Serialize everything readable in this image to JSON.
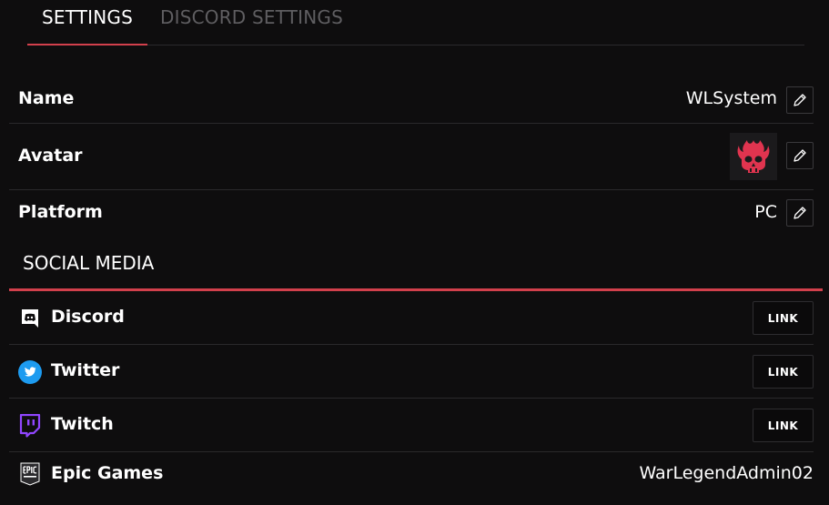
{
  "tabs": [
    {
      "label": "SETTINGS",
      "active": true
    },
    {
      "label": "DISCORD SETTINGS",
      "active": false
    }
  ],
  "settings": {
    "name": {
      "label": "Name",
      "value": "WLSystem"
    },
    "avatar": {
      "label": "Avatar",
      "icon": "flaming-skull-avatar"
    },
    "platform": {
      "label": "Platform",
      "value": "PC"
    }
  },
  "social": {
    "title": "SOCIAL MEDIA",
    "items": [
      {
        "label": "Discord",
        "icon": "discord-icon",
        "action": "LINK"
      },
      {
        "label": "Twitter",
        "icon": "twitter-icon",
        "action": "LINK"
      },
      {
        "label": "Twitch",
        "icon": "twitch-icon",
        "action": "LINK"
      },
      {
        "label": "Epic Games",
        "icon": "epic-games-icon",
        "value": "WarLegendAdmin02"
      }
    ]
  },
  "colors": {
    "background": "#0e0d0e",
    "accent": "#d2404c",
    "tab_inactive": "#5f5e61",
    "twitter": "#1d9bf0",
    "twitch": "#9146ff"
  }
}
